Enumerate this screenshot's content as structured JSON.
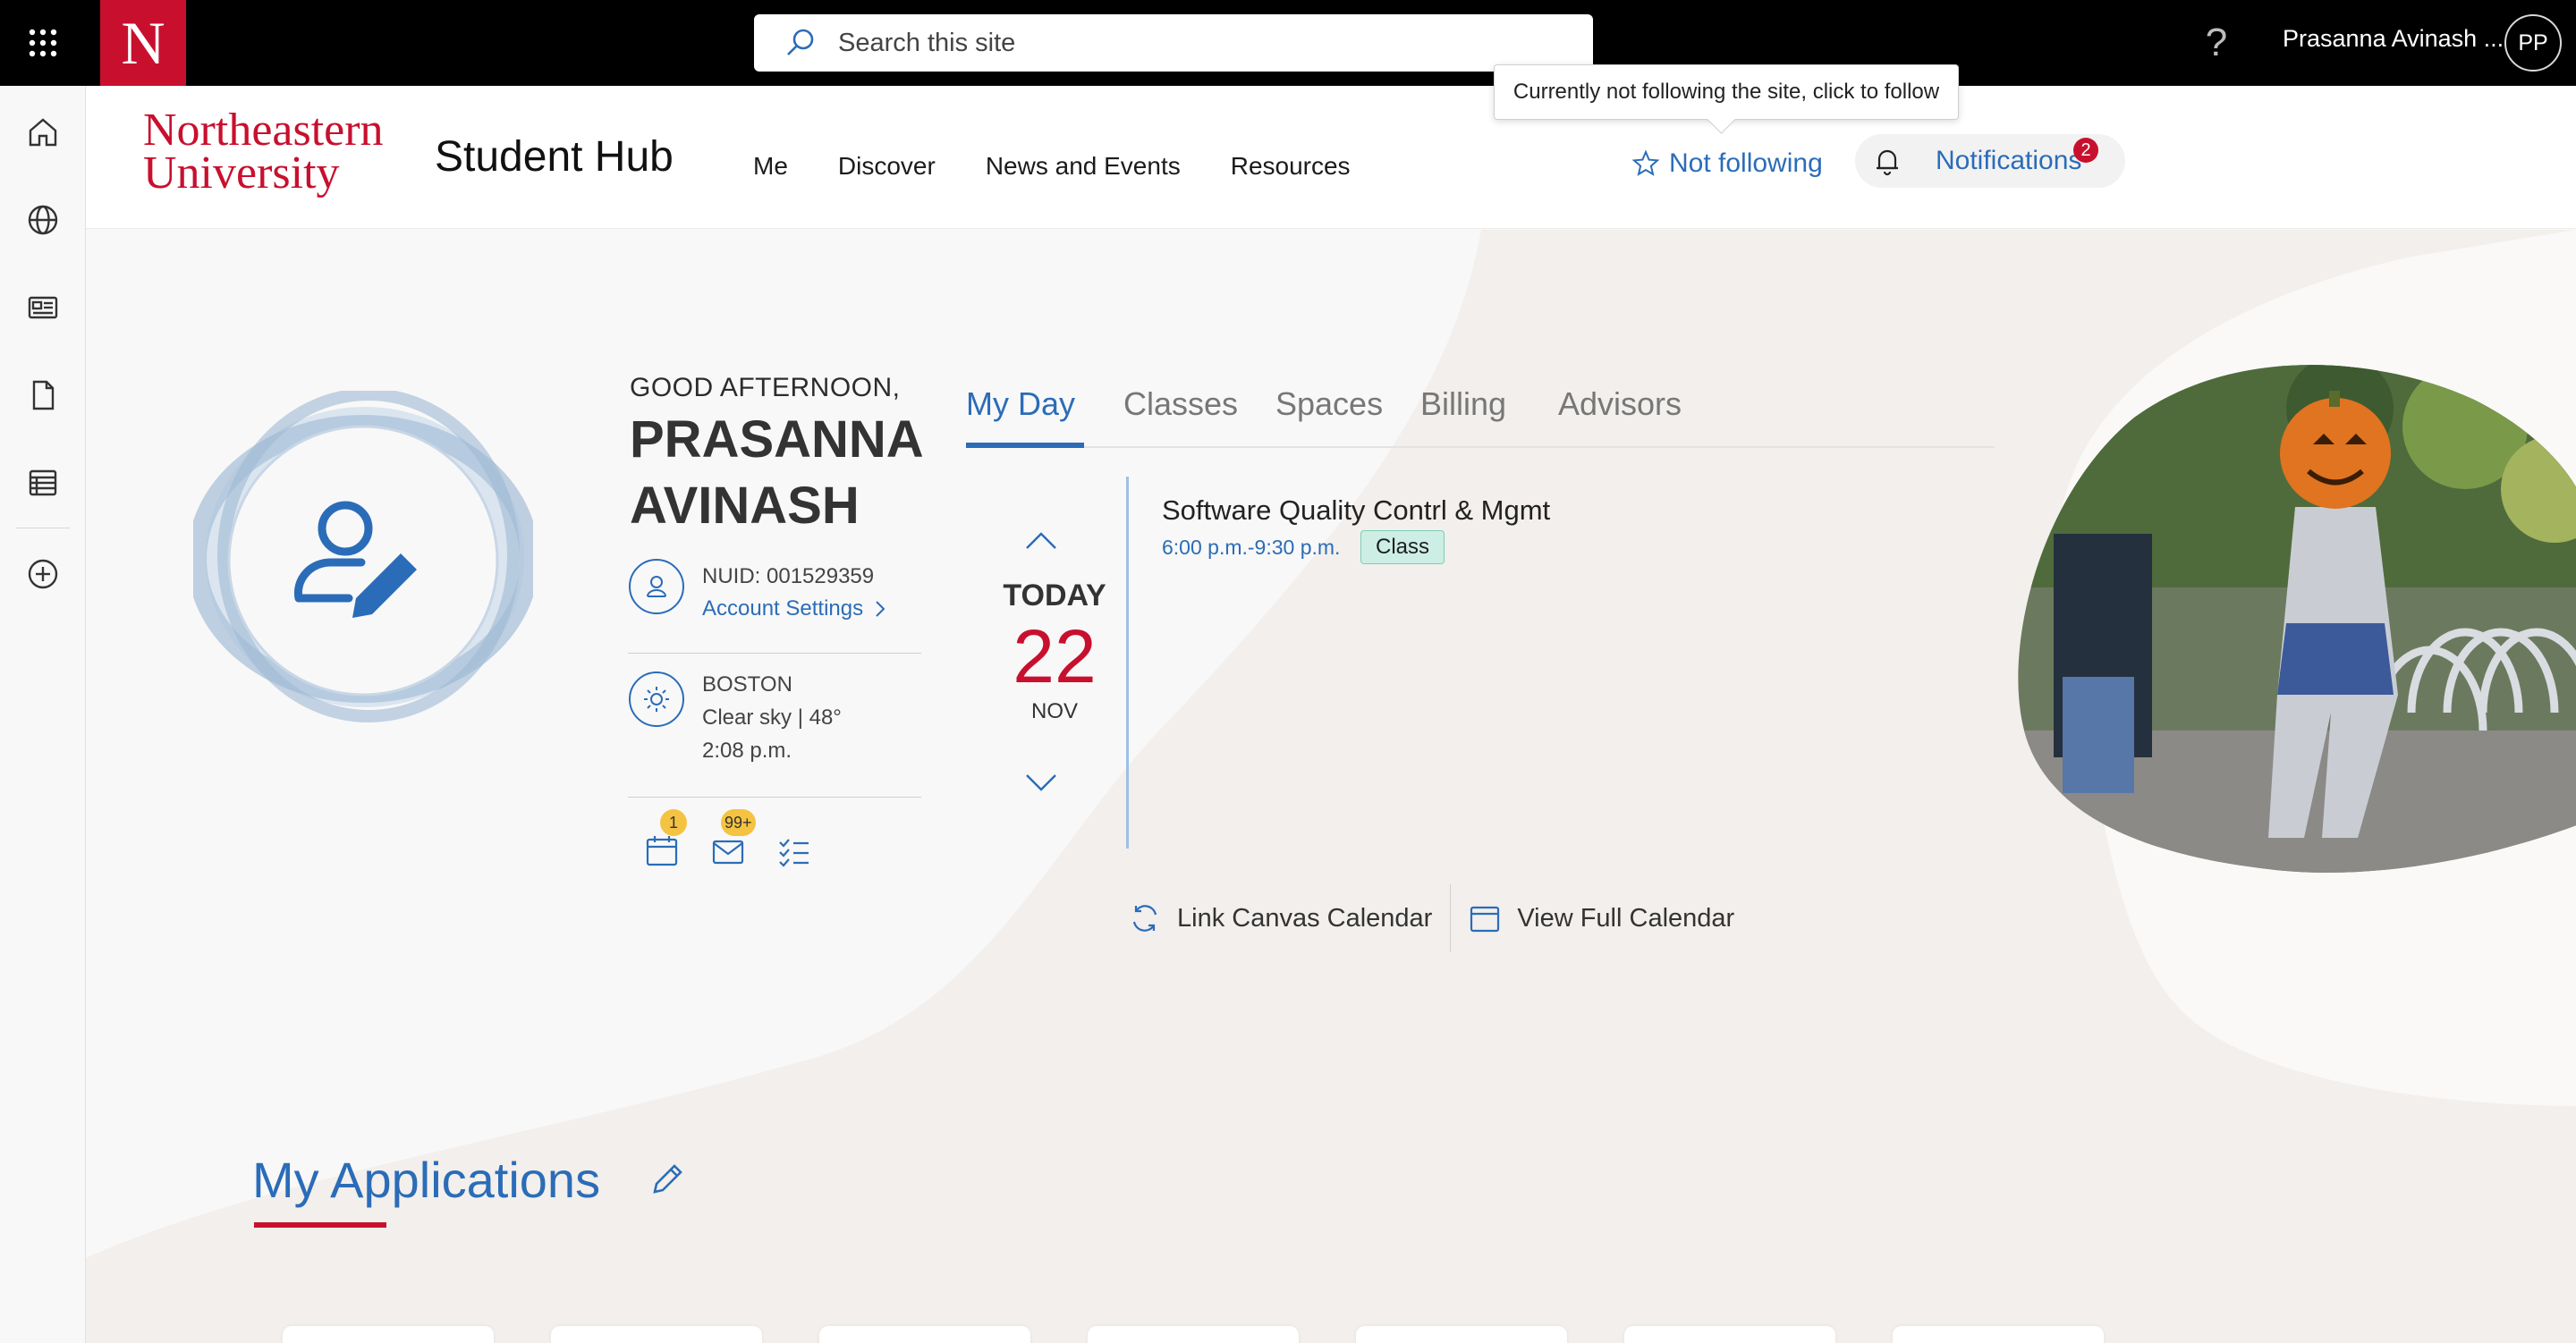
{
  "suite": {
    "logo_letter": "N",
    "search_placeholder": "Search this site",
    "help_glyph": "?",
    "user_name": "Prasanna Avinash ...",
    "user_initials": "PP"
  },
  "appbar": {
    "icons": [
      "home-icon",
      "globe-icon",
      "news-icon",
      "document-icon",
      "list-icon",
      "add-icon"
    ]
  },
  "header": {
    "brand_line1": "Northeastern",
    "brand_line2": "University",
    "site_title": "Student Hub",
    "nav": [
      "Me",
      "Discover",
      "News and Events",
      "Resources"
    ],
    "follow_label": "Not following",
    "follow_tooltip": "Currently not following the site, click to follow",
    "notifications_label": "Notifications",
    "notifications_count": "2"
  },
  "profile": {
    "greeting": "GOOD AFTERNOON,",
    "first_name": "PRASANNA",
    "last_name": "AVINASH",
    "nuid": "NUID: 001529359",
    "account_settings": "Account Settings",
    "city": "BOSTON",
    "weather": "Clear sky | 48°",
    "time": "2:08 p.m.",
    "calendar_badge": "1",
    "mail_badge": "99+"
  },
  "tabs": [
    "My Day",
    "Classes",
    "Spaces",
    "Billing",
    "Advisors"
  ],
  "myday": {
    "today_label": "TODAY",
    "day": "22",
    "month": "NOV",
    "event_title": "Software Quality Contrl & Mgmt",
    "event_time": "6:00 p.m.-9:30 p.m.",
    "event_type": "Class",
    "link_canvas": "Link Canvas Calendar",
    "view_calendar": "View Full Calendar"
  },
  "applications": {
    "title": "My Applications"
  },
  "colors": {
    "accent_blue": "#2b6cb8",
    "brand_red": "#c8102e",
    "badge_yellow": "#f5c342",
    "class_green": "#cdeee5"
  }
}
